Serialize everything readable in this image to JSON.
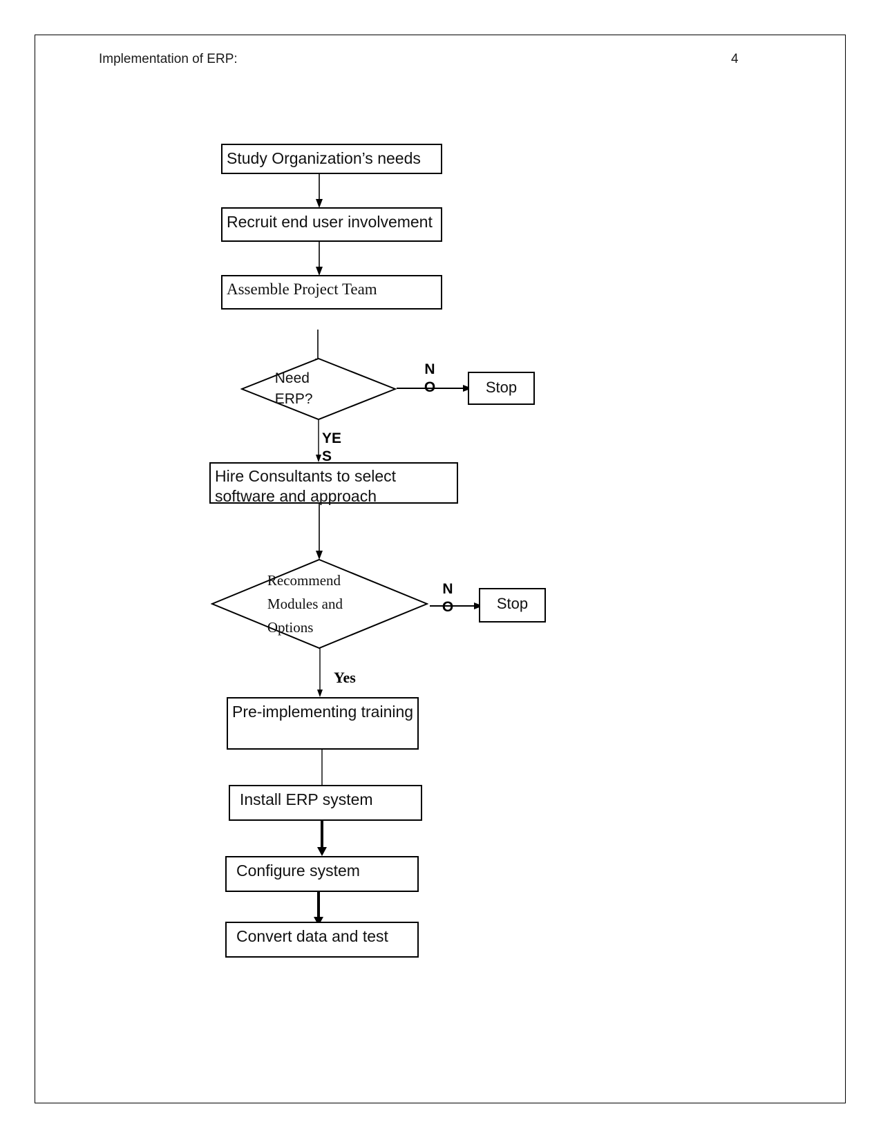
{
  "document": {
    "header_title": "Implementation of ERP:",
    "page_number": "4"
  },
  "flowchart": {
    "title": "ERP Implementation Flowchart",
    "nodes": [
      {
        "id": "study",
        "type": "process",
        "label": "Study Organization’s needs"
      },
      {
        "id": "recruit",
        "type": "process",
        "label": "Recruit end user involvement"
      },
      {
        "id": "assemble",
        "type": "process",
        "label": "Assemble Project Team"
      },
      {
        "id": "need_erp",
        "type": "decision",
        "label": "Need\nERP?"
      },
      {
        "id": "stop1",
        "type": "terminator",
        "label": "Stop"
      },
      {
        "id": "hire",
        "type": "process",
        "label": "Hire Consultants to select software and approach"
      },
      {
        "id": "recommend",
        "type": "decision",
        "label": "Recommend\nModules and\nOptions"
      },
      {
        "id": "stop2",
        "type": "terminator",
        "label": "Stop"
      },
      {
        "id": "pretrain",
        "type": "process",
        "label": "Pre-implementing training"
      },
      {
        "id": "install",
        "type": "process",
        "label": "Install ERP system"
      },
      {
        "id": "configure",
        "type": "process",
        "label": "Configure system"
      },
      {
        "id": "convert",
        "type": "process",
        "label": "Convert data and test"
      }
    ],
    "edge_labels": {
      "need_erp_no": "N\nO",
      "need_erp_yes": "YE\nS",
      "recommend_no": "N\nO",
      "recommend_yes": "Yes"
    },
    "edges": [
      {
        "from": "study",
        "to": "recruit",
        "label": ""
      },
      {
        "from": "recruit",
        "to": "assemble",
        "label": ""
      },
      {
        "from": "assemble",
        "to": "need_erp",
        "label": ""
      },
      {
        "from": "need_erp",
        "to": "stop1",
        "label": "NO"
      },
      {
        "from": "need_erp",
        "to": "hire",
        "label": "YES"
      },
      {
        "from": "hire",
        "to": "recommend",
        "label": ""
      },
      {
        "from": "recommend",
        "to": "stop2",
        "label": "NO"
      },
      {
        "from": "recommend",
        "to": "pretrain",
        "label": "Yes"
      },
      {
        "from": "pretrain",
        "to": "install",
        "label": ""
      },
      {
        "from": "install",
        "to": "configure",
        "label": ""
      },
      {
        "from": "configure",
        "to": "convert",
        "label": ""
      }
    ]
  },
  "colors": {
    "ink": "#000000",
    "paper": "#ffffff",
    "border": "#000000"
  }
}
